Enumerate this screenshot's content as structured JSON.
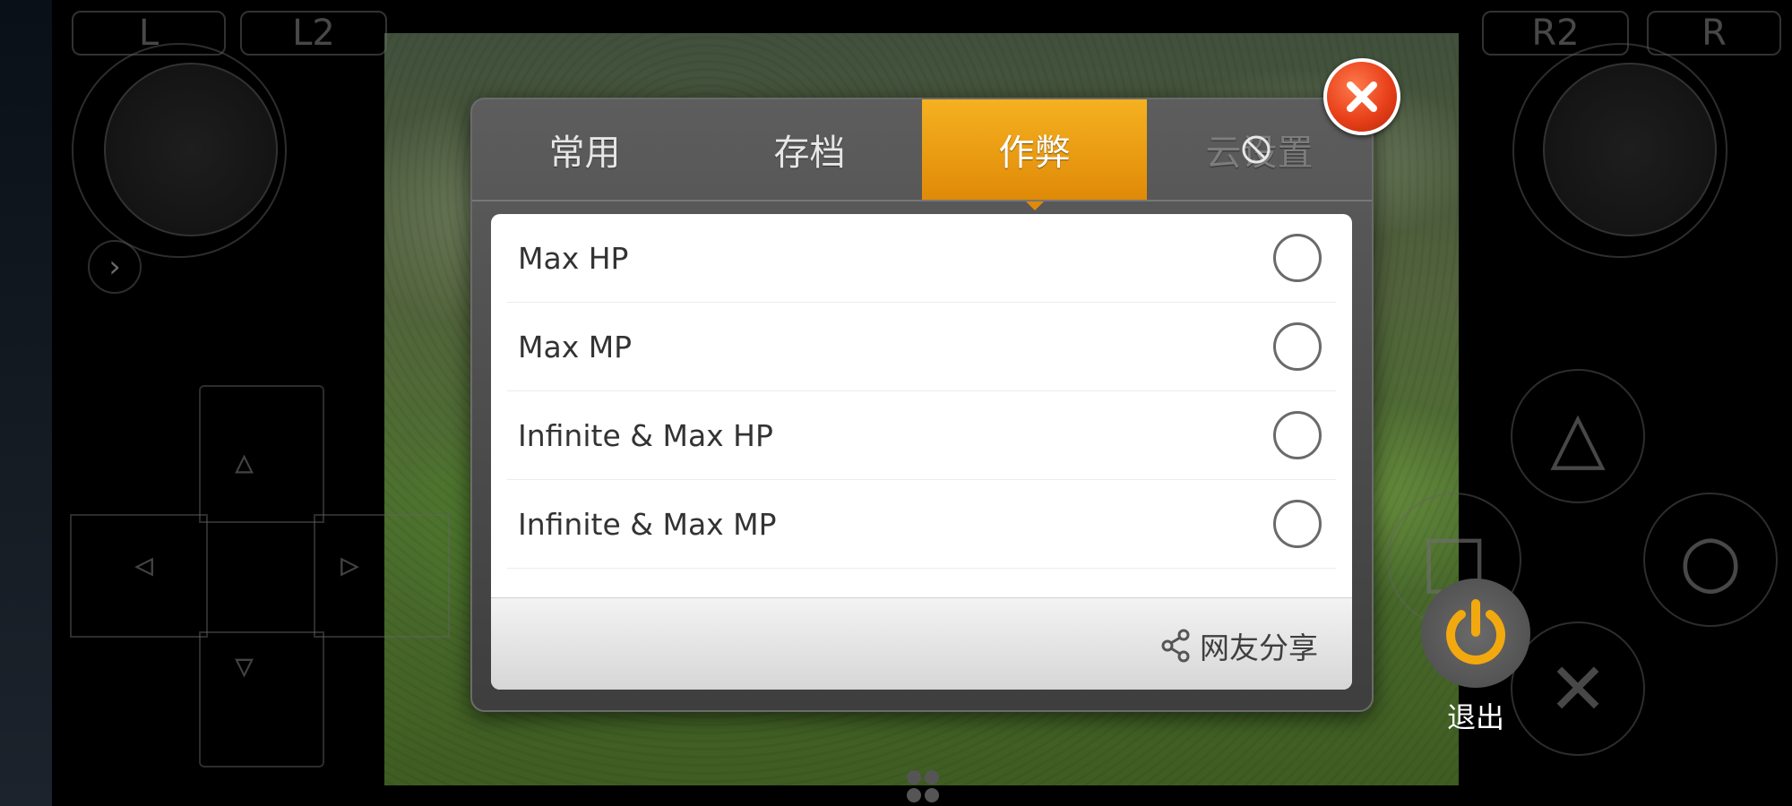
{
  "controller": {
    "shoulder_left": "L",
    "shoulder_left2": "L2",
    "shoulder_right2": "R2",
    "shoulder_right": "R",
    "expand_glyph": "›",
    "triangle_glyph": "△",
    "circle_glyph": "○",
    "cross_glyph": "✕",
    "square_glyph": "□"
  },
  "dialog": {
    "tabs": [
      {
        "label": "常用",
        "state": "normal"
      },
      {
        "label": "存档",
        "state": "normal"
      },
      {
        "label": "作弊",
        "state": "active"
      },
      {
        "label": "云设置",
        "state": "disabled"
      }
    ],
    "cheats": [
      {
        "label": "Max HP",
        "selected": false
      },
      {
        "label": "Max MP",
        "selected": false
      },
      {
        "label": "Infinite & Max HP",
        "selected": false
      },
      {
        "label": "Infinite & Max MP",
        "selected": false
      }
    ],
    "share_label": "网友分享",
    "close_icon": "close-icon"
  },
  "exit": {
    "label": "退出",
    "icon": "power-icon"
  },
  "colors": {
    "accent": "#f0a012",
    "close": "#e8401a",
    "power": "#f2a90f"
  }
}
